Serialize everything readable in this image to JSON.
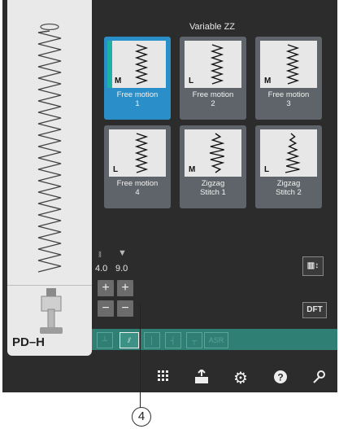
{
  "header": {
    "title": "Variable ZZ"
  },
  "foot_label": "PD–H",
  "tiles": [
    {
      "size": "M",
      "name_line1": "Free motion",
      "name_line2": "1",
      "selected": true
    },
    {
      "size": "L",
      "name_line1": "Free motion",
      "name_line2": "2",
      "selected": false
    },
    {
      "size": "M",
      "name_line1": "Free motion",
      "name_line2": "3",
      "selected": false
    },
    {
      "size": "L",
      "name_line1": "Free motion",
      "name_line2": "4",
      "selected": false
    },
    {
      "size": "M",
      "name_line1": "Zigzag",
      "name_line2": "Stitch 1",
      "selected": false
    },
    {
      "size": "L",
      "name_line1": "Zigzag",
      "name_line2": "Stitch 2",
      "selected": false
    }
  ],
  "adjust": {
    "width": {
      "icon": "stitch-width-icon",
      "value": "4.0",
      "plus": "+",
      "minus": "−"
    },
    "length": {
      "icon": "stitch-length-icon",
      "value": "9.0",
      "plus": "+",
      "minus": "−"
    }
  },
  "side_buttons": {
    "dft": "DFT"
  },
  "strip": {
    "asr_label": "ASR"
  },
  "toolbar": [
    "keypad-icon",
    "download-icon",
    "gear-icon",
    "help-icon",
    "wrench-icon"
  ],
  "callout": {
    "number": "4"
  },
  "colors": {
    "selected_tile": "#2a8fc9",
    "accent": "#1fb0a7",
    "strip": "#2f7f74",
    "tile": "#5e6469"
  }
}
